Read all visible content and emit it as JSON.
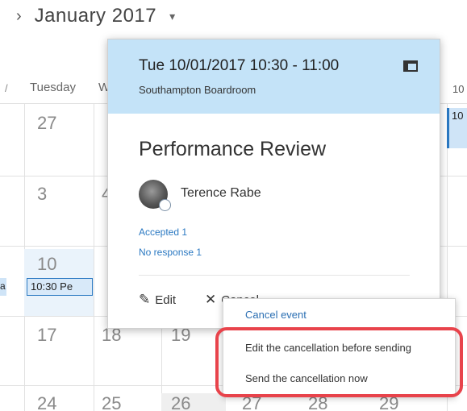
{
  "header": {
    "month_title": "January 2017",
    "nav_icon": "chevron-right-icon",
    "dropdown_icon": "caret-down-icon"
  },
  "calendar": {
    "day_headers": [
      "Tuesday",
      "W"
    ],
    "day_header_right": "10",
    "day_numbers": {
      "w1": [
        "27"
      ],
      "w2": [
        "3",
        "4"
      ],
      "w3": [
        "10"
      ],
      "w4": [
        "17",
        "18",
        "19"
      ],
      "w5": [
        "24",
        "25",
        "26",
        "27",
        "28",
        "29"
      ]
    },
    "event_chip_text": "10:30 Pe",
    "event_chip_left": "a",
    "right_event_text": "10"
  },
  "popup": {
    "time": "Tue 10/01/2017 10:30 - 11:00",
    "location": "Southampton Boardroom",
    "title": "Performance Review",
    "attendee": "Terence Rabe",
    "accepted": "Accepted 1",
    "no_response": "No response 1",
    "edit_label": "Edit",
    "cancel_label": "Cancel"
  },
  "dropdown": {
    "items": [
      "Cancel event",
      "Edit the cancellation before sending",
      "Send the cancellation now"
    ]
  },
  "colors": {
    "accent": "#2b79c2",
    "header_bg": "#c4e3f8",
    "highlight": "#e8434b"
  }
}
